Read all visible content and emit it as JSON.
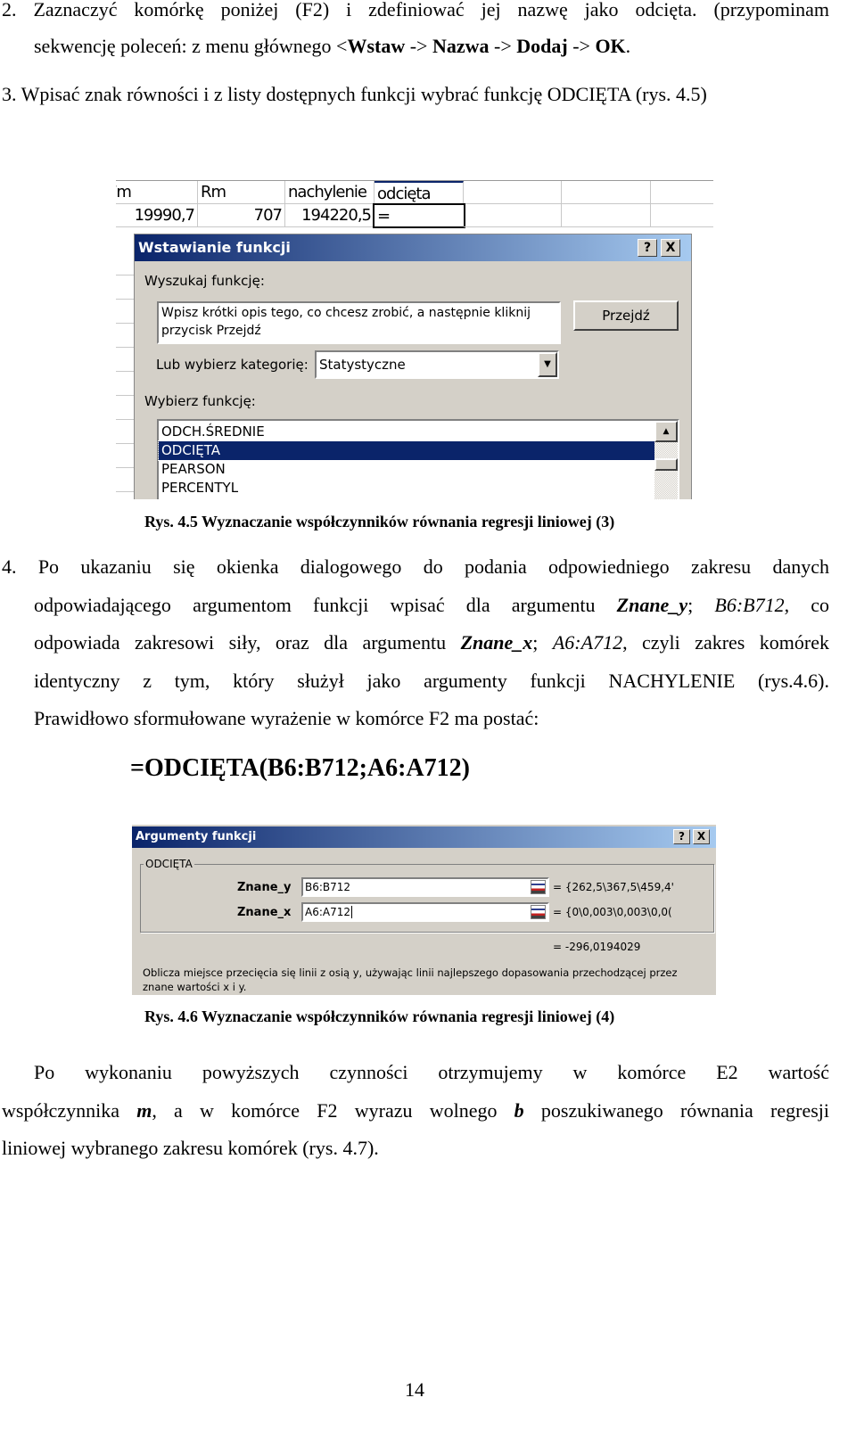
{
  "step2": {
    "line1": "2. Zaznaczyć komórkę poniżej (F2) i zdefiniować jej nazwę jako odcięta. (przypominam",
    "line2_a": "sekwencję poleceń: z menu głównego <",
    "line2_b": "Wstaw",
    "line2_c": " -> ",
    "line2_d": "Nazwa",
    "line2_e": " -> ",
    "line2_f": "Dodaj",
    "line2_g": " -> ",
    "line2_h": "OK",
    "line2_i": "."
  },
  "step3": "3. Wpisać znak równości i z listy dostępnych funkcji wybrać funkcję ODCIĘTA (rys. 4.5)",
  "figure1": {
    "columns": [
      "Fm",
      "Rm",
      "nachylenie",
      "odcięta"
    ],
    "row": [
      "19990,7",
      "707",
      "194220,5",
      "="
    ],
    "dialog_title": "Wstawianie funkcji",
    "help_icon": "?",
    "close_icon": "X",
    "search_label": "Wyszukaj funkcję:",
    "search_text": "Wpisz krótki opis tego, co chcesz zrobić, a następnie kliknij przycisk Przejdź",
    "go_button": "Przejdź",
    "category_label": "Lub wybierz kategorię:",
    "category_value": "Statystyczne",
    "function_label": "Wybierz funkcję:",
    "functions": [
      "ODCH.ŚREDNIE",
      "ODCIĘTA",
      "PEARSON",
      "PERCENTYL"
    ],
    "selected_function": "ODCIĘTA",
    "caption": "Rys. 4.5  Wyznaczanie współczynników równania regresji liniowej (3)"
  },
  "step4": {
    "l1": "4. Po ukazaniu się okienka dialogowego do podania odpowiedniego zakresu danych",
    "l2_a": "odpowiadającego argumentom funkcji wpisać dla argumentu ",
    "l2_b": "Znane_y",
    "l2_c": "; ",
    "l2_d": "B6:B712",
    "l2_e": ", co",
    "l3_a": "odpowiada zakresowi siły, oraz dla argumentu ",
    "l3_b": "Znane_x",
    "l3_c": "; ",
    "l3_d": "A6:A712",
    "l3_e": ", czyli zakres komórek",
    "l4": "identyczny z tym, który służył jako argumenty funkcji NACHYLENIE (rys.4.6).",
    "l5": "Prawidłowo sformułowane wyrażenie w komórce F2 ma postać:"
  },
  "formula": "=ODCIĘTA(B6:B712;A6:A712)",
  "figure2": {
    "dialog_title": "Argumenty funkcji",
    "help_icon": "?",
    "close_icon": "X",
    "group": "ODCIĘTA",
    "arg1_label": "Znane_y",
    "arg1_value": "B6:B712",
    "arg1_result": "= {262,5\\367,5\\459,4'",
    "arg2_label": "Znane_x",
    "arg2_value": "A6:A712",
    "arg2_result": "= {0\\0,003\\0,003\\0,0(",
    "result": "= -296,0194029",
    "description_1": "Oblicza miejsce przecięcia się linii z osią y, używając linii najlepszego dopasowania przechodzącej przez",
    "description_2": "znane wartości x i y.",
    "caption": "Rys. 4.6  Wyznaczanie współczynników równania regresji liniowej (4)"
  },
  "final": {
    "l1": "Po wykonaniu powyższych czynności otrzymujemy w komórce E2 wartość",
    "l2_a": "współczynnika ",
    "l2_b": "m",
    "l2_c": ", a w komórce F2 wyrazu wolnego ",
    "l2_d": "b",
    "l2_e": " poszukiwanego równania regresji",
    "l3": "liniowej wybranego zakresu komórek (rys. 4.7)."
  },
  "page_number": "14"
}
